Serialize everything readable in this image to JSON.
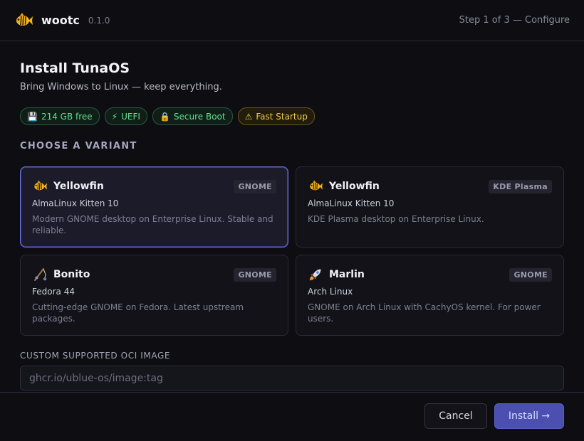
{
  "header": {
    "app_name": "wootc",
    "version": "0.1.0",
    "step": "Step 1 of 3 — Configure",
    "logo_icon": "tuna-fish-icon"
  },
  "main": {
    "title": "Install TunaOS",
    "subtitle": "Bring Windows to Linux — keep everything."
  },
  "badges": [
    {
      "icon": "💾",
      "label": "214 GB free",
      "status": "ok"
    },
    {
      "icon": "⚡",
      "label": "UEFI",
      "status": "ok"
    },
    {
      "icon": "🔒",
      "label": "Secure Boot",
      "status": "ok"
    },
    {
      "icon": "⚠",
      "label": "Fast Startup",
      "status": "warning"
    }
  ],
  "variants": {
    "section_label": "CHOOSE A VARIANT",
    "items": [
      {
        "name": "Yellowfin",
        "tag": "GNOME",
        "os": "AlmaLinux Kitten 10",
        "desc": "Modern GNOME desktop on Enterprise Linux. Stable and reliable.",
        "icon": "tropical-fish-icon",
        "selected": true
      },
      {
        "name": "Yellowfin",
        "tag": "KDE Plasma",
        "os": "AlmaLinux Kitten 10",
        "desc": "KDE Plasma desktop on Enterprise Linux.",
        "icon": "tropical-fish-icon",
        "selected": false
      },
      {
        "name": "Bonito",
        "tag": "GNOME",
        "os": "Fedora 44",
        "desc": "Cutting-edge GNOME on Fedora. Latest upstream packages.",
        "icon": "fishing-pole-icon",
        "selected": false
      },
      {
        "name": "Marlin",
        "tag": "GNOME",
        "os": "Arch Linux",
        "desc": "GNOME on Arch Linux with CachyOS kernel. For power users.",
        "icon": "rocket-icon",
        "selected": false
      }
    ]
  },
  "oci": {
    "label": "CUSTOM SUPPORTED OCI IMAGE",
    "placeholder": "ghcr.io/ublue-os/image:tag",
    "value": ""
  },
  "footer": {
    "cancel_label": "Cancel",
    "install_label": "Install →"
  },
  "colors": {
    "accent": "#4a4fb0",
    "selected_border": "#6f72d9",
    "ok": "#5ee08e",
    "warning": "#f2c84a",
    "fish_yellow": "#f6b31a"
  }
}
